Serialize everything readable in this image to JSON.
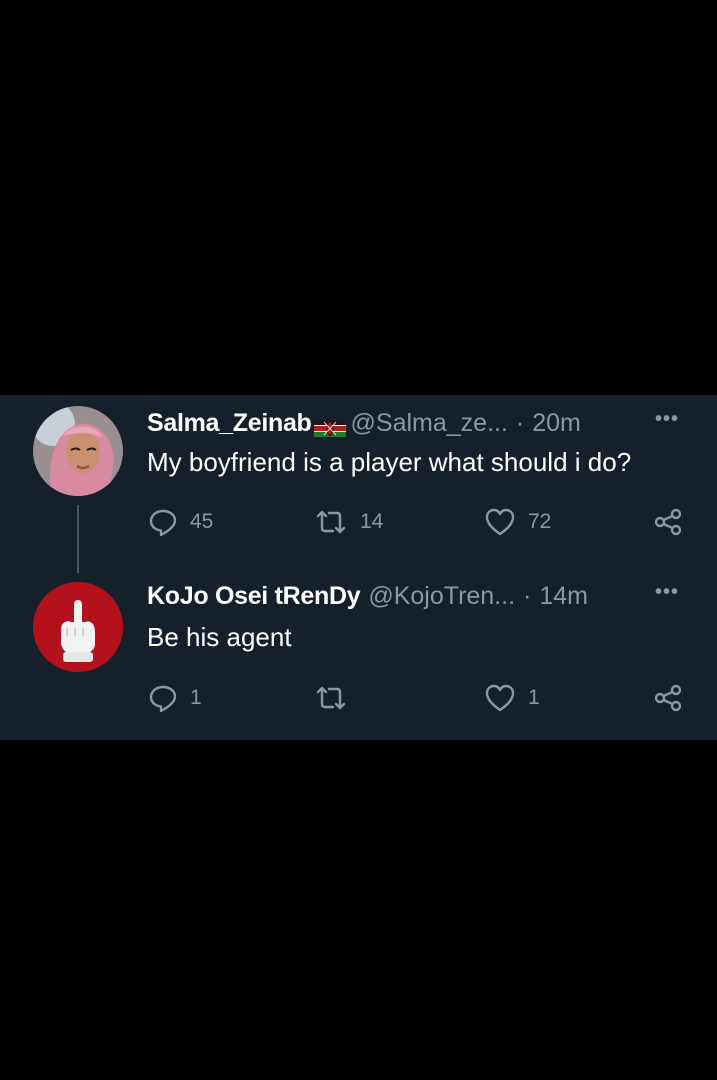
{
  "thread": {
    "tweets": [
      {
        "display_name": "Salma_Zeinab",
        "handle": "@Salma_ze...",
        "separator": "·",
        "time": "20m",
        "more_label": "•••",
        "text": "My boyfriend is a player what should i do?",
        "reply_count": "45",
        "retweet_count": "14",
        "like_count": "72",
        "icons": {
          "avatar": "profile-photo",
          "flag": "kenya-flag-icon",
          "reply": "reply-icon",
          "retweet": "retweet-icon",
          "like": "heart-icon",
          "share": "share-icon"
        }
      },
      {
        "display_name": "KoJo Osei tRenDy",
        "handle": "@KojoTren...",
        "separator": "·",
        "time": "14m",
        "more_label": "•••",
        "text": "Be his agent",
        "reply_count": "1",
        "retweet_count": "",
        "like_count": "1",
        "icons": {
          "avatar": "profile-photo",
          "reply": "reply-icon",
          "retweet": "retweet-icon",
          "like": "heart-icon",
          "share": "share-icon"
        }
      }
    ]
  },
  "colors": {
    "page_background": "#000000",
    "card_background": "#15202b",
    "primary_text": "#ffffff",
    "secondary_text": "#8899a6"
  }
}
